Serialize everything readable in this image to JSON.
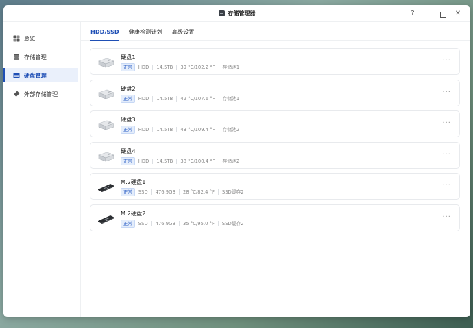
{
  "window": {
    "title": "存储管理器"
  },
  "controls": {
    "help": "?",
    "close": "✕"
  },
  "sidebar": {
    "items": [
      {
        "label": "总览",
        "icon": "overview-icon"
      },
      {
        "label": "存储管理",
        "icon": "database-icon"
      },
      {
        "label": "硬盘管理",
        "icon": "disk-icon",
        "active": true
      },
      {
        "label": "外部存储管理",
        "icon": "usb-drive-icon"
      }
    ]
  },
  "tabs": [
    {
      "label": "HDD/SSD",
      "active": true
    },
    {
      "label": "健康检测计划"
    },
    {
      "label": "高级设置"
    }
  ],
  "disks": [
    {
      "name": "硬盘1",
      "status": "正常",
      "type": "HDD",
      "size": "14.5TB",
      "temp": "39 °C/102.2 °F",
      "pool": "存储池1",
      "kind": "hdd"
    },
    {
      "name": "硬盘2",
      "status": "正常",
      "type": "HDD",
      "size": "14.5TB",
      "temp": "42 °C/107.6 °F",
      "pool": "存储池1",
      "kind": "hdd"
    },
    {
      "name": "硬盘3",
      "status": "正常",
      "type": "HDD",
      "size": "14.5TB",
      "temp": "43 °C/109.4 °F",
      "pool": "存储池2",
      "kind": "hdd"
    },
    {
      "name": "硬盘4",
      "status": "正常",
      "type": "HDD",
      "size": "14.5TB",
      "temp": "38 °C/100.4 °F",
      "pool": "存储池2",
      "kind": "hdd"
    },
    {
      "name": "M.2硬盘1",
      "status": "正常",
      "type": "SSD",
      "size": "476.9GB",
      "temp": "28 °C/82.4 °F",
      "pool": "SSD缓存2",
      "kind": "m2"
    },
    {
      "name": "M.2硬盘2",
      "status": "正常",
      "type": "SSD",
      "size": "476.9GB",
      "temp": "35 °C/95.0 °F",
      "pool": "SSD缓存2",
      "kind": "m2"
    }
  ],
  "more_label": "···",
  "colors": {
    "accent": "#1f4fb5",
    "badge_bg": "#e4edfb"
  }
}
